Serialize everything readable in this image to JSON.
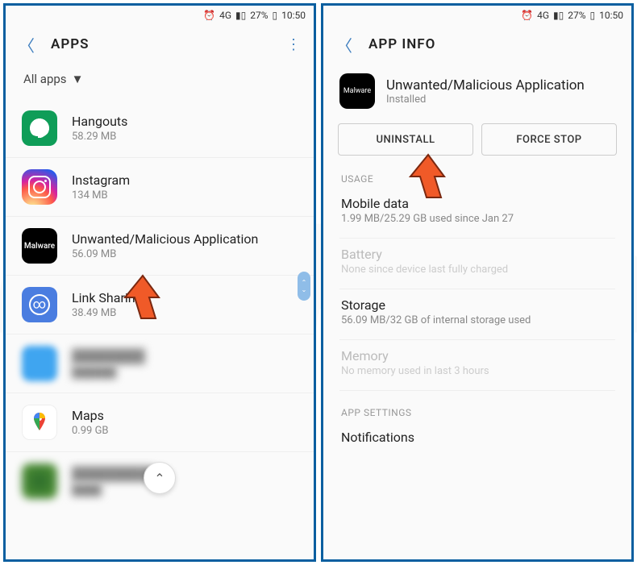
{
  "status": {
    "network": "4G",
    "battery_pct": "27%",
    "time": "10:50"
  },
  "left": {
    "title": "APPS",
    "filter": "All apps",
    "items": [
      {
        "name": "Hangouts",
        "size": "58.29 MB"
      },
      {
        "name": "Instagram",
        "size": "134 MB"
      },
      {
        "name": "Unwanted/Malicious Application",
        "size": "56.09 MB"
      },
      {
        "name": "Link Sharing",
        "size": "38.49 MB"
      },
      {
        "name": "",
        "size": ""
      },
      {
        "name": "Maps",
        "size": "0.99 GB"
      },
      {
        "name": "",
        "size": ""
      }
    ]
  },
  "right": {
    "title": "APP INFO",
    "app_name": "Unwanted/Malicious Application",
    "app_status": "Installed",
    "uninstall": "UNINSTALL",
    "force_stop": "FORCE STOP",
    "usage_label": "USAGE",
    "mobile_data": {
      "title": "Mobile data",
      "sub": "1.99 MB/25.29 GB used since Jan 27"
    },
    "battery": {
      "title": "Battery",
      "sub": "None since device last fully charged"
    },
    "storage": {
      "title": "Storage",
      "sub": "56.09 MB/32 GB of internal storage used"
    },
    "memory": {
      "title": "Memory",
      "sub": "No memory used in last 3 hours"
    },
    "app_settings_label": "APP SETTINGS",
    "notifications": "Notifications"
  },
  "malware_icon_label": "Malware"
}
